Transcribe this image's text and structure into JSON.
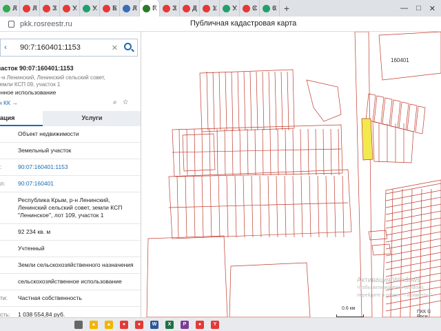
{
  "browser": {
    "tabs": [
      {
        "letter": "Л",
        "color": "#34a853"
      },
      {
        "letter": "Л",
        "color": "#e53935"
      },
      {
        "letter": "З",
        "color": "#e53935"
      },
      {
        "letter": "У",
        "color": "#e53935"
      },
      {
        "letter": "У",
        "color": "#22a06b"
      },
      {
        "letter": "Б",
        "color": "#e53935"
      },
      {
        "letter": "Л",
        "color": "#3b6cb7"
      },
      {
        "letter": "Г",
        "color": "#2b7a2b",
        "active": true
      },
      {
        "letter": "З",
        "color": "#e53935"
      },
      {
        "letter": "Д",
        "color": "#e53935"
      },
      {
        "letter": "1",
        "color": "#e53935"
      },
      {
        "letter": "У",
        "color": "#22a06b"
      },
      {
        "letter": "С",
        "color": "#e53935"
      },
      {
        "letter": "6",
        "color": "#22a06b"
      }
    ],
    "close_glyph": "X",
    "new_tab": "+",
    "window_controls": [
      "—",
      "□",
      "✕"
    ],
    "url": "pkk.rosreestr.ru",
    "page_title": "Публичная кадастровая карта"
  },
  "sidebar": {
    "search_value": "90:7:160401:1153",
    "object_title": "часток 90:07:160401:1153",
    "object_subtitle": "р-н Ленинский, Ленинский сельский совет, земли КСП 09, участок 1",
    "object_use": "енное использование",
    "object_link": "н КК →",
    "tab_info": "ация",
    "tab_services": "Услуги",
    "rows": [
      {
        "k": "",
        "v": "Объект недвижимости",
        "link": false
      },
      {
        "k": "",
        "v": "Земельный участок",
        "link": false
      },
      {
        "k": ":",
        "v": "90:07:160401:1153",
        "link": true
      },
      {
        "k": "л:",
        "v": "90:07:160401",
        "link": true
      },
      {
        "k": "",
        "v": "Республика Крым, р-н Ленинский, Ленинский сельский совет, земли КСП \"Ленинское\", лот 109, участок 1",
        "link": false
      },
      {
        "k": "",
        "v": "92 234 кв. м",
        "link": false
      },
      {
        "k": "",
        "v": "Учтенный",
        "link": false
      },
      {
        "k": "",
        "v": "Земли сельскохозяйственного назначения",
        "link": false
      },
      {
        "k": "",
        "v": "сельскохозяйственное использование",
        "link": false
      },
      {
        "k": "ти:",
        "v": "Частная собственность",
        "link": false
      },
      {
        "k": "сть:",
        "v": "1 038 554,84 руб.",
        "link": false
      }
    ]
  },
  "map": {
    "quarter_label": "160401",
    "scale_label": "0.6 км",
    "watermark_line1": "Активация Windows",
    "watermark_line2": "Чтобы активировать Windows, перейдите в раздел \"Параметры\".",
    "copyright": "ПКК © Роси",
    "line_color": "#c0392b",
    "highlight_color": "#f2e94e"
  },
  "taskbar": {
    "apps": [
      {
        "label": "",
        "color": "#666"
      },
      {
        "label": "▲",
        "color": "#f4b400"
      },
      {
        "label": "▲",
        "color": "#f4b400"
      },
      {
        "label": "●",
        "color": "#e53935"
      },
      {
        "label": "●",
        "color": "#e53935"
      },
      {
        "label": "W",
        "color": "#2b579a"
      },
      {
        "label": "X",
        "color": "#1e7145"
      },
      {
        "label": "P",
        "color": "#7d3c98"
      },
      {
        "label": "●",
        "color": "#e53935"
      },
      {
        "label": "Y",
        "color": "#e53935"
      }
    ]
  }
}
